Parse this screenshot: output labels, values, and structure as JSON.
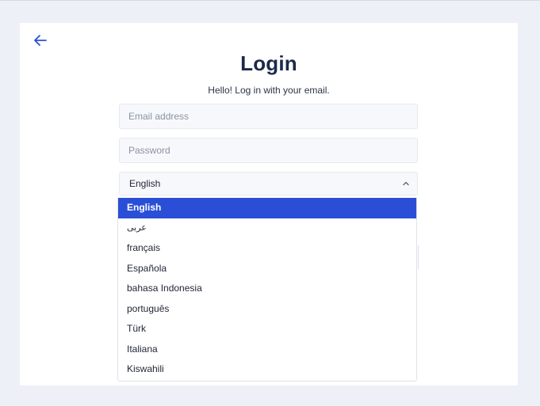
{
  "page": {
    "title": "Login",
    "subtitle": "Hello! Log in with your email."
  },
  "form": {
    "email_placeholder": "Email address",
    "password_placeholder": "Password",
    "language_selected": "English"
  },
  "language_options": [
    {
      "label": "English",
      "selected": true
    },
    {
      "label": "عربى",
      "selected": false
    },
    {
      "label": "français",
      "selected": false
    },
    {
      "label": "Española",
      "selected": false
    },
    {
      "label": "bahasa Indonesia",
      "selected": false
    },
    {
      "label": "português",
      "selected": false
    },
    {
      "label": "Türk",
      "selected": false
    },
    {
      "label": "Italiana",
      "selected": false
    },
    {
      "label": "Kiswahili",
      "selected": false
    }
  ],
  "icons": {
    "back": "arrow-left-icon",
    "select_toggle": "chevron-up-icon"
  },
  "colors": {
    "page_background": "#edf0f7",
    "card_background": "#ffffff",
    "title": "#1b2a4a",
    "accent": "#2a4fd6"
  }
}
